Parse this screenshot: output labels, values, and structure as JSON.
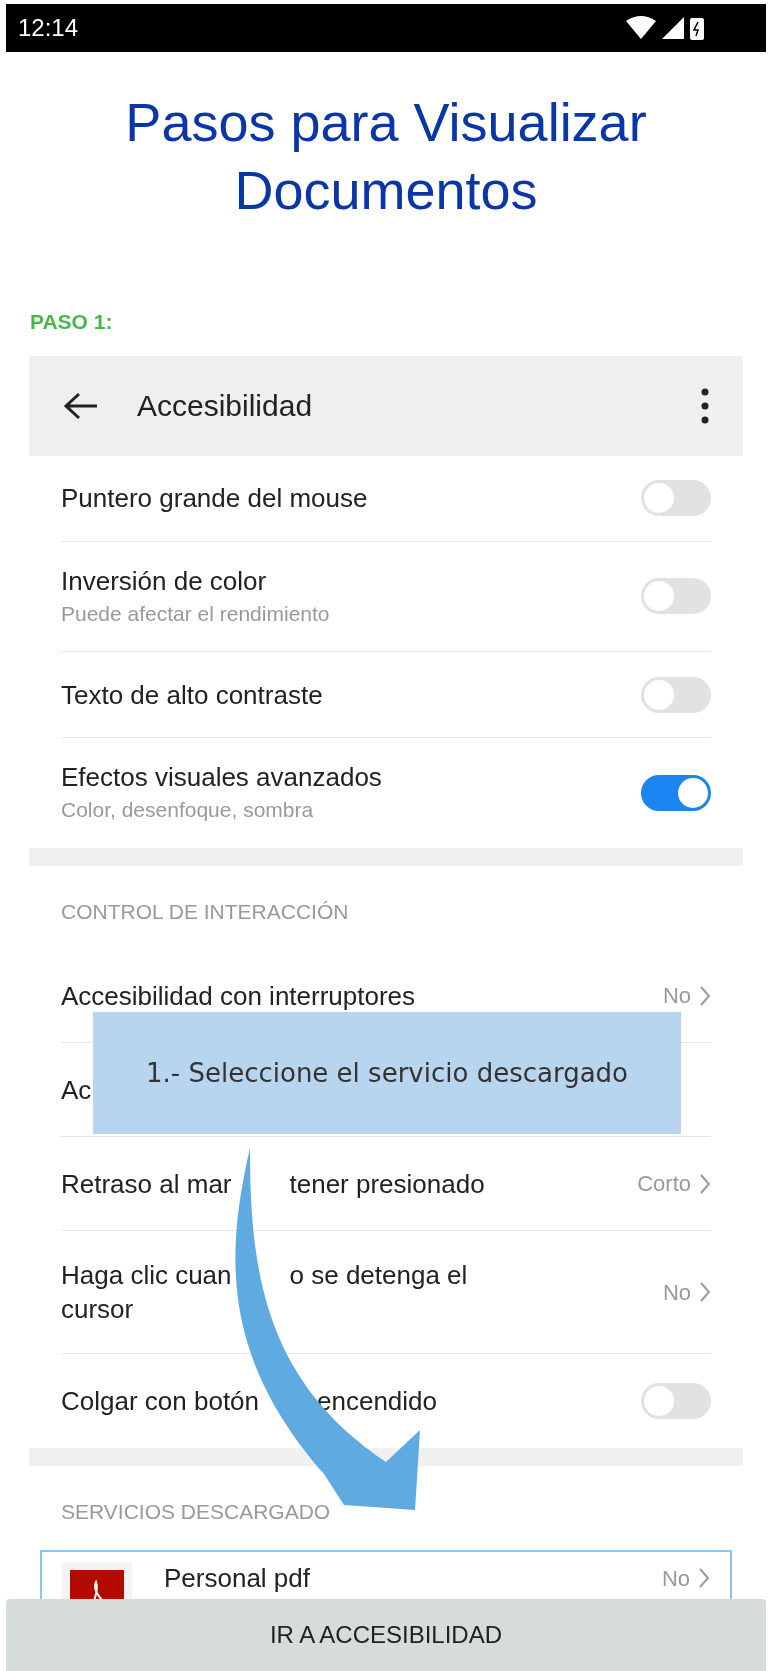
{
  "status_bar": {
    "time": "12:14"
  },
  "title": "Pasos para Visualizar Documentos",
  "step_label": "PASO 1:",
  "screenshot": {
    "header": {
      "title": "Accesibilidad"
    },
    "sections": [
      {
        "rows": [
          {
            "kind": "toggle",
            "label": "Puntero grande del mouse",
            "on": false
          },
          {
            "kind": "toggle",
            "label": "Inversión de color",
            "sublabel": "Puede afectar el rendimiento",
            "on": false
          },
          {
            "kind": "toggle",
            "label": "Texto de alto contraste",
            "on": false
          },
          {
            "kind": "toggle",
            "label": "Efectos visuales avanzados",
            "sublabel": "Color, desenfoque, sombra",
            "on": true
          }
        ]
      },
      {
        "heading": "CONTROL DE INTERACCIÓN",
        "rows": [
          {
            "kind": "value",
            "label": "Accesibilidad con interruptores",
            "value": "No"
          },
          {
            "kind": "value",
            "label": "Ac"
          },
          {
            "kind": "value",
            "label_lines": [
              [
                "Retraso al mar",
                "tener presionado"
              ]
            ],
            "value": "Corto"
          },
          {
            "kind": "value",
            "label_lines": [
              [
                "Haga clic cuan",
                "o se detenga el"
              ],
              [
                "cursor"
              ]
            ],
            "value": "No"
          },
          {
            "kind": "toggle",
            "label_lines": [
              [
                "Colgar con botón",
                "encendido"
              ]
            ],
            "on": false
          }
        ]
      },
      {
        "heading": "SERVICIOS DESCARGADO",
        "rows": [
          {
            "kind": "app",
            "label": "Personal pdf",
            "value": "No"
          }
        ]
      }
    ]
  },
  "callout": "1.- Seleccione el servicio descargado",
  "bottom_button": "IR A ACCESIBILIDAD"
}
